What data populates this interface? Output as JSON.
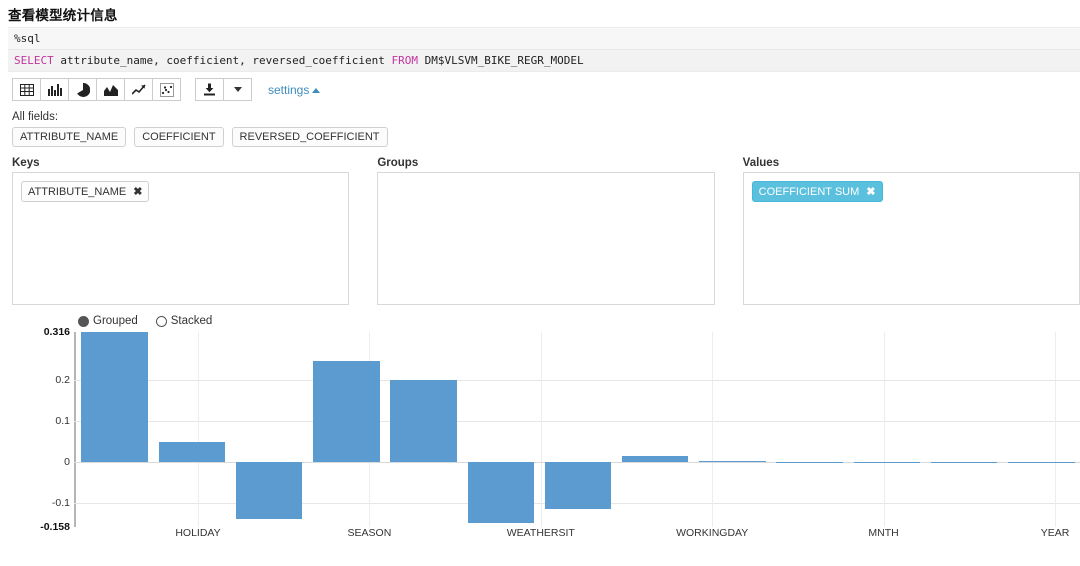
{
  "page": {
    "heading": "查看模型统计信息"
  },
  "code": {
    "interpreter": "%sql",
    "statement_parts": [
      {
        "t": "SELECT",
        "kw": true
      },
      {
        "t": " attribute_name, coefficient, reversed_coefficient ",
        "kw": false
      },
      {
        "t": "FROM",
        "kw": true
      },
      {
        "t": " DM$VLSVM_BIKE_REGR_MODEL",
        "kw": false
      }
    ],
    "statement_plain": "SELECT attribute_name, coefficient, reversed_coefficient FROM DM$VLSVM_BIKE_REGR_MODEL"
  },
  "toolbar": {
    "chart_buttons": [
      {
        "name": "table-icon",
        "title": "Table"
      },
      {
        "name": "bar-chart-icon",
        "title": "Bar Chart"
      },
      {
        "name": "pie-chart-icon",
        "title": "Pie Chart"
      },
      {
        "name": "area-chart-icon",
        "title": "Area Chart"
      },
      {
        "name": "line-chart-icon",
        "title": "Line Chart"
      },
      {
        "name": "scatter-chart-icon",
        "title": "Scatter Chart"
      }
    ],
    "download_icon": "download-icon",
    "download_caret_icon": "chevron-down-icon",
    "settings_label": "settings",
    "settings_caret_icon": "caret-up-icon"
  },
  "fields": {
    "label": "All fields:",
    "items": [
      "ATTRIBUTE_NAME",
      "COEFFICIENT",
      "REVERSED_COEFFICIENT"
    ]
  },
  "zones": [
    {
      "label": "Keys",
      "name": "keys",
      "chips": [
        {
          "text": "ATTRIBUTE_NAME",
          "accent": false,
          "remove": "✖"
        }
      ]
    },
    {
      "label": "Groups",
      "name": "groups",
      "chips": []
    },
    {
      "label": "Values",
      "name": "values",
      "chips": [
        {
          "text": "COEFFICIENT  SUM",
          "accent": true,
          "remove": "✖"
        }
      ]
    }
  ],
  "chart_mode": {
    "options": [
      {
        "label": "Grouped",
        "selected": true
      },
      {
        "label": "Stacked",
        "selected": false
      }
    ]
  },
  "colors": {
    "bar": "#5b9bd0",
    "accent": "#5bc0de",
    "link": "#3c8dbc",
    "keyword": "#c2359d",
    "grid": "#e6e6e6"
  },
  "chart_data": {
    "type": "bar",
    "title": "",
    "xlabel": "ATTRIBUTE_NAME",
    "ylabel": "COEFFICIENT SUM",
    "ylim": [
      -0.158,
      0.316
    ],
    "yticks": [
      0.316,
      0.2,
      0.1,
      0,
      -0.1,
      -0.158
    ],
    "ytick_labels": [
      "0.316",
      "0.2",
      "0.1",
      "0",
      "-0.1",
      "-0.158"
    ],
    "grid": true,
    "legend": "none",
    "visible_xtick_labels": [
      "HOLIDAY",
      "SEASON",
      "WEATHERSIT",
      "WORKINGDAY",
      "MNTH",
      "YEAR"
    ],
    "bars": [
      {
        "value": 0.316
      },
      {
        "value": 0.05
      },
      {
        "value": -0.139
      },
      {
        "value": 0.245
      },
      {
        "value": 0.2
      },
      {
        "value": -0.147
      },
      {
        "value": -0.114
      },
      {
        "value": 0.015
      },
      {
        "value": 0.002
      },
      {
        "value": 0.001
      },
      {
        "value": 0.001
      },
      {
        "value": 0.001
      },
      {
        "value": 0.001
      }
    ]
  }
}
